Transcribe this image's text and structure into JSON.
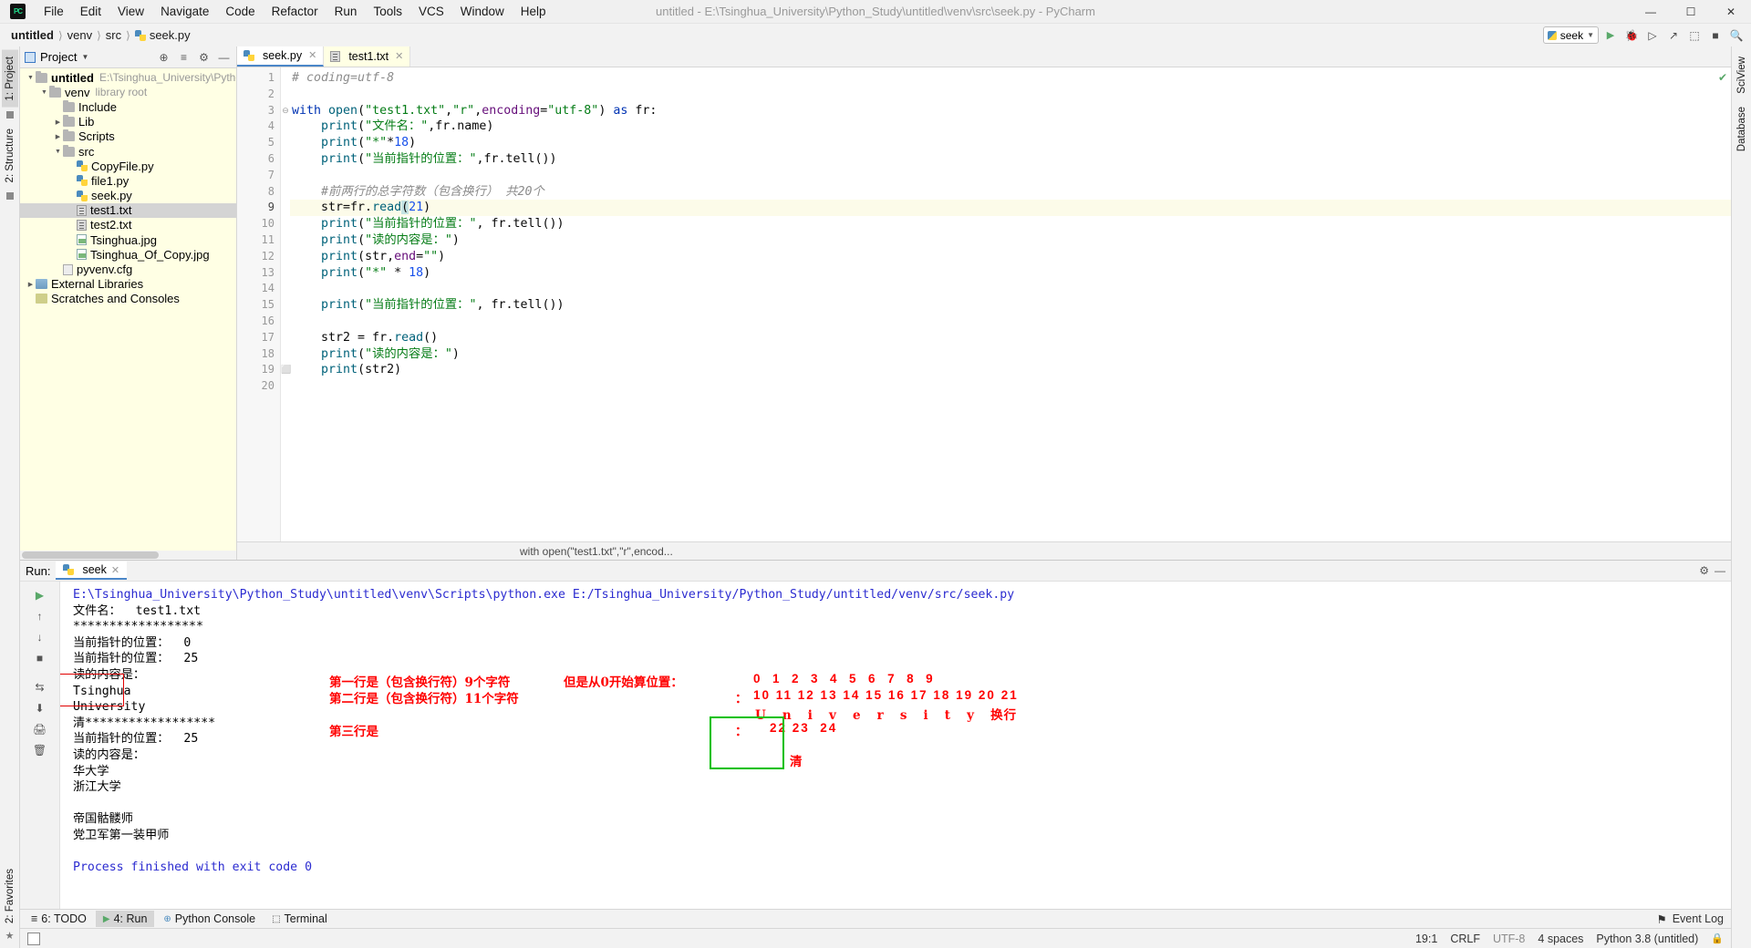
{
  "window": {
    "title": "untitled - E:\\Tsinghua_University\\Python_Study\\untitled\\venv\\src\\seek.py - PyCharm",
    "minimize": "—",
    "maximize": "☐",
    "close": "✕"
  },
  "menu": [
    "File",
    "Edit",
    "View",
    "Navigate",
    "Code",
    "Refactor",
    "Run",
    "Tools",
    "VCS",
    "Window",
    "Help"
  ],
  "breadcrumb": {
    "project": "untitled",
    "venv": "venv",
    "src": "src",
    "file": "seek.py"
  },
  "toolbar": {
    "run_config": "seek",
    "run": "▶",
    "debug": "🐞",
    "coverage": "▷",
    "profile": "↗",
    "attach": "⬚",
    "stop": "■",
    "search": "🔍"
  },
  "left_rail": {
    "project_tab": "1: Project",
    "structure_tab": "2: Structure",
    "favorites_tab": "2: Favorites"
  },
  "right_rail": {
    "sciview": "SciView",
    "database": "Database"
  },
  "project_panel": {
    "title": "Project",
    "locate_icon": "⊕",
    "collapse_icon": "≡",
    "settings_icon": "⚙",
    "hide_icon": "—",
    "tree": [
      {
        "label": "untitled",
        "note": "E:\\Tsinghua_University\\Python_Stud",
        "indent": 0,
        "arrow": "▼",
        "kind": "folder",
        "bold": true
      },
      {
        "label": "venv",
        "note": "library root",
        "indent": 1,
        "arrow": "▼",
        "kind": "folder",
        "bold": false
      },
      {
        "label": "Include",
        "note": "",
        "indent": 2,
        "arrow": "",
        "kind": "folder",
        "bold": false
      },
      {
        "label": "Lib",
        "note": "",
        "indent": 2,
        "arrow": "▶",
        "kind": "folder",
        "bold": false
      },
      {
        "label": "Scripts",
        "note": "",
        "indent": 2,
        "arrow": "▶",
        "kind": "folder",
        "bold": false
      },
      {
        "label": "src",
        "note": "",
        "indent": 2,
        "arrow": "▼",
        "kind": "folder",
        "bold": false
      },
      {
        "label": "CopyFile.py",
        "note": "",
        "indent": 3,
        "arrow": "",
        "kind": "py",
        "bold": false
      },
      {
        "label": "file1.py",
        "note": "",
        "indent": 3,
        "arrow": "",
        "kind": "py",
        "bold": false
      },
      {
        "label": "seek.py",
        "note": "",
        "indent": 3,
        "arrow": "",
        "kind": "py",
        "bold": false
      },
      {
        "label": "test1.txt",
        "note": "",
        "indent": 3,
        "arrow": "",
        "kind": "txt",
        "bold": false,
        "selected": true
      },
      {
        "label": "test2.txt",
        "note": "",
        "indent": 3,
        "arrow": "",
        "kind": "txt",
        "bold": false
      },
      {
        "label": "Tsinghua.jpg",
        "note": "",
        "indent": 3,
        "arrow": "",
        "kind": "img",
        "bold": false
      },
      {
        "label": "Tsinghua_Of_Copy.jpg",
        "note": "",
        "indent": 3,
        "arrow": "",
        "kind": "img",
        "bold": false
      },
      {
        "label": "pyvenv.cfg",
        "note": "",
        "indent": 2,
        "arrow": "",
        "kind": "cfg",
        "bold": false
      },
      {
        "label": "External Libraries",
        "note": "",
        "indent": 0,
        "arrow": "▶",
        "kind": "ext",
        "bold": false
      },
      {
        "label": "Scratches and Consoles",
        "note": "",
        "indent": 0,
        "arrow": "",
        "kind": "scr",
        "bold": false
      }
    ]
  },
  "editor": {
    "tabs": [
      {
        "label": "seek.py",
        "kind": "py",
        "active": true,
        "close": "✕"
      },
      {
        "label": "test1.txt",
        "kind": "txt",
        "active": false,
        "close": "✕"
      }
    ],
    "line_numbers": [
      "1",
      "2",
      "3",
      "4",
      "5",
      "6",
      "7",
      "8",
      "9",
      "10",
      "11",
      "12",
      "13",
      "14",
      "15",
      "16",
      "17",
      "18",
      "19",
      "20"
    ],
    "current_line": 9,
    "status_hint": "with open(\"test1.txt\",\"r\",encod...",
    "inspection_icon": "✔",
    "lines": [
      {
        "n": 1,
        "tokens": [
          {
            "t": "# coding=utf-8",
            "c": "cmt"
          }
        ]
      },
      {
        "n": 2,
        "tokens": []
      },
      {
        "n": 3,
        "fold": "⊖",
        "tokens": [
          {
            "t": "with ",
            "c": "kw"
          },
          {
            "t": "open",
            "c": "fn"
          },
          {
            "t": "(",
            "c": "pl"
          },
          {
            "t": "\"test1.txt\"",
            "c": "str"
          },
          {
            "t": ",",
            "c": "pl"
          },
          {
            "t": "\"r\"",
            "c": "str"
          },
          {
            "t": ",",
            "c": "pl"
          },
          {
            "t": "encoding",
            "c": "prm"
          },
          {
            "t": "=",
            "c": "pl"
          },
          {
            "t": "\"utf-8\"",
            "c": "str"
          },
          {
            "t": ") ",
            "c": "pl"
          },
          {
            "t": "as",
            "c": "kw"
          },
          {
            "t": " fr:",
            "c": "pl"
          }
        ]
      },
      {
        "n": 4,
        "tokens": [
          {
            "t": "    ",
            "c": "pl"
          },
          {
            "t": "print",
            "c": "fn"
          },
          {
            "t": "(",
            "c": "pl"
          },
          {
            "t": "\"文件名：\"",
            "c": "str"
          },
          {
            "t": ",fr.name)",
            "c": "pl"
          }
        ]
      },
      {
        "n": 5,
        "tokens": [
          {
            "t": "    ",
            "c": "pl"
          },
          {
            "t": "print",
            "c": "fn"
          },
          {
            "t": "(",
            "c": "pl"
          },
          {
            "t": "\"*\"",
            "c": "str"
          },
          {
            "t": "*",
            "c": "pl"
          },
          {
            "t": "18",
            "c": "num"
          },
          {
            "t": ")",
            "c": "pl"
          }
        ]
      },
      {
        "n": 6,
        "tokens": [
          {
            "t": "    ",
            "c": "pl"
          },
          {
            "t": "print",
            "c": "fn"
          },
          {
            "t": "(",
            "c": "pl"
          },
          {
            "t": "\"当前指针的位置：\"",
            "c": "str"
          },
          {
            "t": ",fr.tell())",
            "c": "pl"
          }
        ]
      },
      {
        "n": 7,
        "tokens": []
      },
      {
        "n": 8,
        "tokens": [
          {
            "t": "    #前两行的总字符数（包含换行） 共20个",
            "c": "cmt"
          }
        ]
      },
      {
        "n": 9,
        "hl": true,
        "tokens": [
          {
            "t": "    str=fr.",
            "c": "pl"
          },
          {
            "t": "read",
            "c": "fn"
          },
          {
            "t": "(",
            "c": "caret"
          },
          {
            "t": "21",
            "c": "num"
          },
          {
            "t": ")",
            "c": "pl"
          }
        ]
      },
      {
        "n": 10,
        "tokens": [
          {
            "t": "    ",
            "c": "pl"
          },
          {
            "t": "print",
            "c": "fn"
          },
          {
            "t": "(",
            "c": "pl"
          },
          {
            "t": "\"当前指针的位置：\"",
            "c": "str"
          },
          {
            "t": ", fr.tell())",
            "c": "pl"
          }
        ]
      },
      {
        "n": 11,
        "tokens": [
          {
            "t": "    ",
            "c": "pl"
          },
          {
            "t": "print",
            "c": "fn"
          },
          {
            "t": "(",
            "c": "pl"
          },
          {
            "t": "\"读的内容是：\"",
            "c": "str"
          },
          {
            "t": ")",
            "c": "pl"
          }
        ]
      },
      {
        "n": 12,
        "tokens": [
          {
            "t": "    ",
            "c": "pl"
          },
          {
            "t": "print",
            "c": "fn"
          },
          {
            "t": "(str,",
            "c": "pl"
          },
          {
            "t": "end",
            "c": "prm"
          },
          {
            "t": "=",
            "c": "pl"
          },
          {
            "t": "\"\"",
            "c": "str"
          },
          {
            "t": ")",
            "c": "pl"
          }
        ]
      },
      {
        "n": 13,
        "tokens": [
          {
            "t": "    ",
            "c": "pl"
          },
          {
            "t": "print",
            "c": "fn"
          },
          {
            "t": "(",
            "c": "pl"
          },
          {
            "t": "\"*\"",
            "c": "str"
          },
          {
            "t": " * ",
            "c": "pl"
          },
          {
            "t": "18",
            "c": "num"
          },
          {
            "t": ")",
            "c": "pl"
          }
        ]
      },
      {
        "n": 14,
        "tokens": []
      },
      {
        "n": 15,
        "tokens": [
          {
            "t": "    ",
            "c": "pl"
          },
          {
            "t": "print",
            "c": "fn"
          },
          {
            "t": "(",
            "c": "pl"
          },
          {
            "t": "\"当前指针的位置：\"",
            "c": "str"
          },
          {
            "t": ", fr.tell())",
            "c": "pl"
          }
        ]
      },
      {
        "n": 16,
        "tokens": []
      },
      {
        "n": 17,
        "tokens": [
          {
            "t": "    str2 = fr.",
            "c": "pl"
          },
          {
            "t": "read",
            "c": "fn"
          },
          {
            "t": "()",
            "c": "pl"
          }
        ]
      },
      {
        "n": 18,
        "tokens": [
          {
            "t": "    ",
            "c": "pl"
          },
          {
            "t": "print",
            "c": "fn"
          },
          {
            "t": "(",
            "c": "pl"
          },
          {
            "t": "\"读的内容是：\"",
            "c": "str"
          },
          {
            "t": ")",
            "c": "pl"
          }
        ]
      },
      {
        "n": 19,
        "fold": "⬜",
        "tokens": [
          {
            "t": "    ",
            "c": "pl"
          },
          {
            "t": "print",
            "c": "fn"
          },
          {
            "t": "(str2)",
            "c": "pl"
          }
        ]
      },
      {
        "n": 20,
        "tokens": []
      }
    ]
  },
  "run_panel": {
    "label": "Run:",
    "tab": "seek",
    "tab_close": "✕",
    "settings_icon": "⚙",
    "hide_icon": "—",
    "side_buttons": [
      "▶",
      "↑",
      "↓",
      "■",
      "⇆",
      "⬇",
      "🖨",
      "🗑"
    ],
    "output": [
      {
        "t": "E:\\Tsinghua_University\\Python_Study\\untitled\\venv\\Scripts\\python.exe E:/Tsinghua_University/Python_Study/untitled/venv/src/seek.py",
        "cls": "cmd"
      },
      {
        "t": "文件名：  test1.txt",
        "cls": ""
      },
      {
        "t": "******************",
        "cls": ""
      },
      {
        "t": "当前指针的位置：  0",
        "cls": ""
      },
      {
        "t": "当前指针的位置：  25",
        "cls": ""
      },
      {
        "t": "读的内容是：",
        "cls": ""
      },
      {
        "t": "Tsinghua",
        "cls": ""
      },
      {
        "t": "University",
        "cls": ""
      },
      {
        "t": "清******************",
        "cls": ""
      },
      {
        "t": "当前指针的位置：  25",
        "cls": ""
      },
      {
        "t": "读的内容是：",
        "cls": ""
      },
      {
        "t": "华大学",
        "cls": ""
      },
      {
        "t": "浙江大学",
        "cls": ""
      },
      {
        "t": "",
        "cls": ""
      },
      {
        "t": "帝国骷髅师",
        "cls": ""
      },
      {
        "t": "党卫军第一装甲师",
        "cls": ""
      },
      {
        "t": "",
        "cls": ""
      },
      {
        "t": "Process finished with exit code 0",
        "cls": "cmd"
      }
    ],
    "annotations": {
      "line1": "第一行是（包含换行符）9个字符",
      "line2": "第二行是（包含换行符）11个字符",
      "line3": "第三行是",
      "pos_intro": "但是从0开始算位置：",
      "row0": "0  1  2  3  4  5  6  7  8  9",
      "row1_colon": "：",
      "row1": "10 11 12 13 14 15 16 17 18 19 20 21",
      "chars": "U   n   i   v   e   r   s   i   t   y   换行",
      "row2_colon": "：",
      "row2": "22 23  24",
      "char_last": "清"
    }
  },
  "bottom_bar": {
    "items": [
      {
        "icon": "≡",
        "label": "6: TODO",
        "active": false
      },
      {
        "icon": "▶",
        "label": "4: Run",
        "active": true
      },
      {
        "icon": "⊕",
        "label": "Python Console",
        "active": false
      },
      {
        "icon": "⬚",
        "label": "Terminal",
        "active": false
      }
    ],
    "event_log": "Event Log",
    "event_icon": "⚑"
  },
  "status_bar": {
    "caret": "19:1",
    "line_sep": "CRLF",
    "encoding": "UTF-8",
    "indent": "4 spaces",
    "interpreter": "Python 3.8 (untitled)",
    "lock_icon": "🔒"
  }
}
